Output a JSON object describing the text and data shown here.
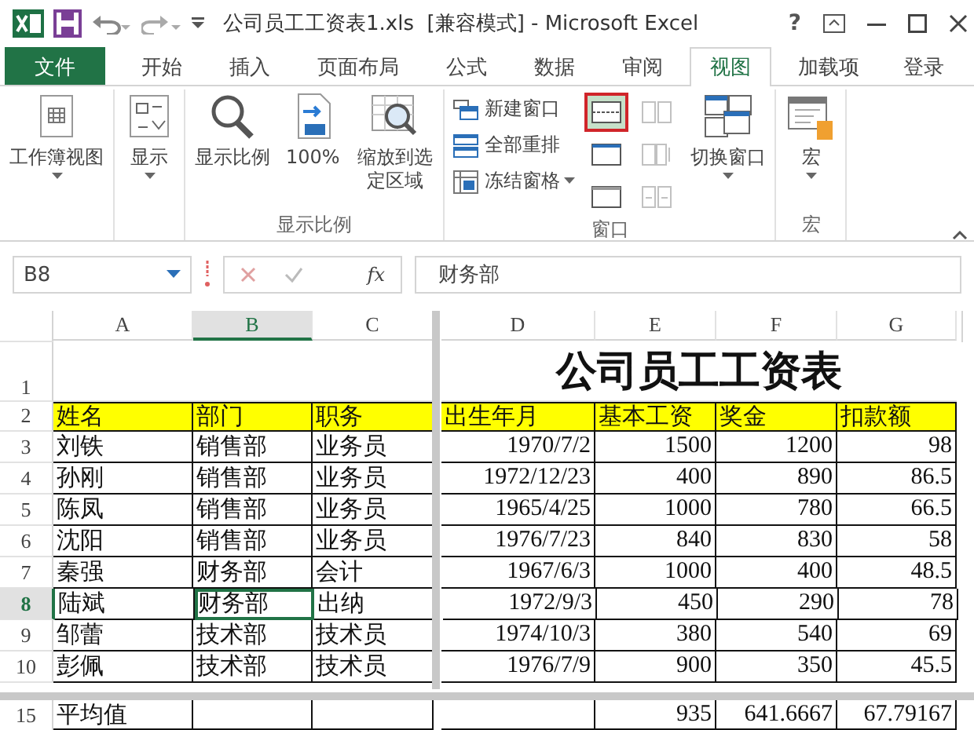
{
  "title_bar": {
    "title": "公司员工工资表1.xls  [兼容模式] - Microsoft Excel",
    "help": "?"
  },
  "tabs": [
    {
      "label": "文件",
      "kind": "file",
      "selected": false
    },
    {
      "label": "开始",
      "kind": "tab",
      "selected": false
    },
    {
      "label": "插入",
      "kind": "tab",
      "selected": false
    },
    {
      "label": "页面布局",
      "kind": "tab",
      "selected": false
    },
    {
      "label": "公式",
      "kind": "tab",
      "selected": false
    },
    {
      "label": "数据",
      "kind": "tab",
      "selected": false
    },
    {
      "label": "审阅",
      "kind": "tab",
      "selected": false
    },
    {
      "label": "视图",
      "kind": "tab",
      "selected": true
    },
    {
      "label": "加载项",
      "kind": "tab",
      "selected": false
    },
    {
      "label": "登录",
      "kind": "account",
      "selected": false
    }
  ],
  "ribbon": {
    "groups": [
      {
        "buttons": [
          {
            "kind": "large",
            "label": "工作簿视图",
            "dropdown": true
          }
        ]
      },
      {
        "buttons": [
          {
            "kind": "large",
            "label": "显示",
            "dropdown": true
          }
        ]
      },
      {
        "label": "显示比例",
        "buttons": [
          {
            "kind": "large",
            "label": "显示比例"
          },
          {
            "kind": "large",
            "label": "100%"
          },
          {
            "kind": "large",
            "label": "缩放到选定区域"
          }
        ]
      },
      {
        "label": "窗口",
        "buttons": [
          {
            "kind": "small_stack",
            "items": [
              {
                "label": "新建窗口"
              },
              {
                "label": "全部重排"
              },
              {
                "label": "冻结窗格",
                "dropdown": true
              }
            ]
          },
          {
            "kind": "icon_column",
            "disabled": false,
            "icons": [
              {
                "highlighted": true
              },
              {
                "highlighted": false
              },
              {
                "highlighted": false
              }
            ]
          },
          {
            "kind": "icon_column",
            "disabled": true,
            "icons": [
              {
                "highlighted": false
              },
              {
                "highlighted": false
              },
              {
                "highlighted": false
              }
            ]
          },
          {
            "kind": "large",
            "label": "切换窗口",
            "dropdown": true
          }
        ]
      },
      {
        "label": "宏",
        "buttons": [
          {
            "kind": "large",
            "label": "宏",
            "dropdown": true
          }
        ]
      }
    ]
  },
  "formula_bar": {
    "name_box": "B8",
    "function_label": "fx",
    "formula": "财务部"
  },
  "sheet": {
    "columns": [
      {
        "label": "A",
        "selected": false
      },
      {
        "label": "B",
        "selected": true
      },
      {
        "label": "C",
        "selected": false
      },
      {
        "label": "D",
        "selected": false
      },
      {
        "label": "E",
        "selected": false
      },
      {
        "label": "F",
        "selected": false
      },
      {
        "label": "G",
        "selected": false
      }
    ],
    "rows": [
      {
        "header": "1",
        "selected": false,
        "kind": "title",
        "cells": [
          null,
          null,
          null,
          "公司员工工资表"
        ]
      },
      {
        "header": "2",
        "selected": false,
        "kind": "heading",
        "cells": [
          "姓名",
          "部门",
          "职务",
          "出生年月",
          "基本工资",
          "奖金",
          "扣款额"
        ]
      },
      {
        "header": "3",
        "selected": false,
        "kind": "data",
        "cells": [
          "刘铁",
          "销售部",
          "业务员",
          "1970/7/2",
          "1500",
          "1200",
          "98"
        ]
      },
      {
        "header": "4",
        "selected": false,
        "kind": "data",
        "cells": [
          "孙刚",
          "销售部",
          "业务员",
          "1972/12/23",
          "400",
          "890",
          "86.5"
        ]
      },
      {
        "header": "5",
        "selected": false,
        "kind": "data",
        "cells": [
          "陈凤",
          "销售部",
          "业务员",
          "1965/4/25",
          "1000",
          "780",
          "66.5"
        ]
      },
      {
        "header": "6",
        "selected": false,
        "kind": "data",
        "cells": [
          "沈阳",
          "销售部",
          "业务员",
          "1976/7/23",
          "840",
          "830",
          "58"
        ]
      },
      {
        "header": "7",
        "selected": false,
        "kind": "data",
        "cells": [
          "秦强",
          "财务部",
          "会计",
          "1967/6/3",
          "1000",
          "400",
          "48.5"
        ]
      },
      {
        "header": "8",
        "selected": true,
        "kind": "data",
        "cells": [
          "陆斌",
          {
            "text": "财务部",
            "selected": true
          },
          "出纳",
          "1972/9/3",
          "450",
          "290",
          "78"
        ]
      },
      {
        "header": "9",
        "selected": false,
        "kind": "data",
        "cells": [
          "邹蕾",
          "技术部",
          "技术员",
          "1974/10/3",
          "380",
          "540",
          "69"
        ]
      },
      {
        "header": "10",
        "selected": false,
        "kind": "data",
        "cells": [
          "彭佩",
          "技术部",
          "技术员",
          "1976/7/9",
          "900",
          "350",
          "45.5"
        ]
      },
      {
        "header": "15",
        "selected": false,
        "kind": "summary",
        "cells": [
          "平均值",
          null,
          null,
          null,
          "935",
          "641.6667",
          "67.79167"
        ]
      }
    ]
  }
}
